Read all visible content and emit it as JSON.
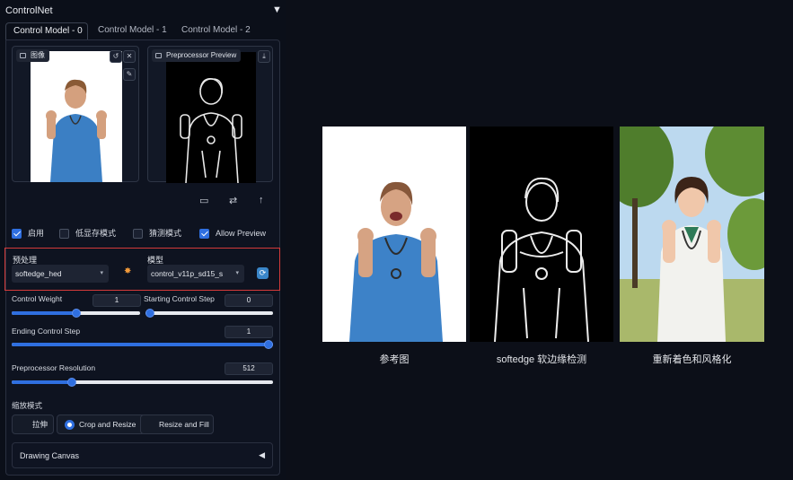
{
  "panel": {
    "title": "ControlNet",
    "collapse_icon": "triangle-down-icon"
  },
  "tabs": [
    "Control Model - 0",
    "Control Model - 1",
    "Control Model - 2"
  ],
  "image_input": {
    "label": "图像"
  },
  "preview": {
    "label": "Preprocessor Preview"
  },
  "checks": [
    {
      "label": "启用",
      "checked": true
    },
    {
      "label": "低显存模式",
      "checked": false
    },
    {
      "label": "猜测模式",
      "checked": false
    },
    {
      "label": "Allow Preview",
      "checked": true
    }
  ],
  "preprocessor": {
    "label": "预处理",
    "value": "softedge_hed"
  },
  "model": {
    "label": "模型",
    "value": "control_v11p_sd15_s"
  },
  "sliders": {
    "control_weight": {
      "label": "Control Weight",
      "value": "1",
      "fraction": 0.5
    },
    "starting_step": {
      "label": "Starting Control Step",
      "value": "0",
      "fraction": 0.0
    },
    "ending_step": {
      "label": "Ending Control Step",
      "value": "1",
      "fraction": 1.0
    },
    "resolution": {
      "label": "Preprocessor Resolution",
      "value": "512",
      "fraction": 0.23
    }
  },
  "resize": {
    "label": "缩放模式",
    "options": [
      "拉伸",
      "Crop and Resize",
      "Resize and Fill"
    ],
    "selected": "Crop and Resize"
  },
  "drawing_canvas": {
    "label": "Drawing Canvas"
  },
  "comparison": {
    "captions": [
      "参考图",
      "softedge 软边缘检测",
      "重新着色和风格化"
    ]
  },
  "colors": {
    "accent": "#2f6fe0",
    "highlight_border": "#d43a3a"
  }
}
